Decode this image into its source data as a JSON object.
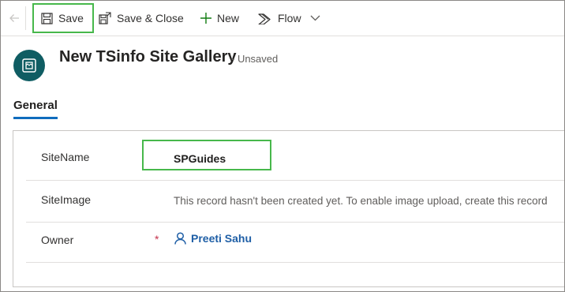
{
  "toolbar": {
    "save_label": "Save",
    "save_close_label": "Save & Close",
    "new_label": "New",
    "flow_label": "Flow"
  },
  "header": {
    "title": "New TSinfo Site Gallery",
    "status": "- Unsaved"
  },
  "tabs": [
    {
      "label": "General",
      "selected": true
    }
  ],
  "form": {
    "site_name": {
      "label": "SiteName",
      "required_mark": "*",
      "value": "SPGuides"
    },
    "site_image": {
      "label": "SiteImage",
      "message": "This record hasn't been created yet. To enable image upload, create this record"
    },
    "owner": {
      "label": "Owner",
      "required_mark": "*",
      "value": "Preeti Sahu"
    }
  },
  "colors": {
    "highlight_border": "#47b84b",
    "entity_icon_bg": "#0f5d63",
    "tab_underline": "#0f6cbd",
    "link": "#1f5fa6",
    "required": "#c4314b"
  },
  "icons": [
    "back-arrow-icon",
    "save-icon",
    "save-close-icon",
    "plus-icon",
    "flow-icon",
    "chevron-down-icon",
    "entity-icon",
    "person-icon"
  ]
}
